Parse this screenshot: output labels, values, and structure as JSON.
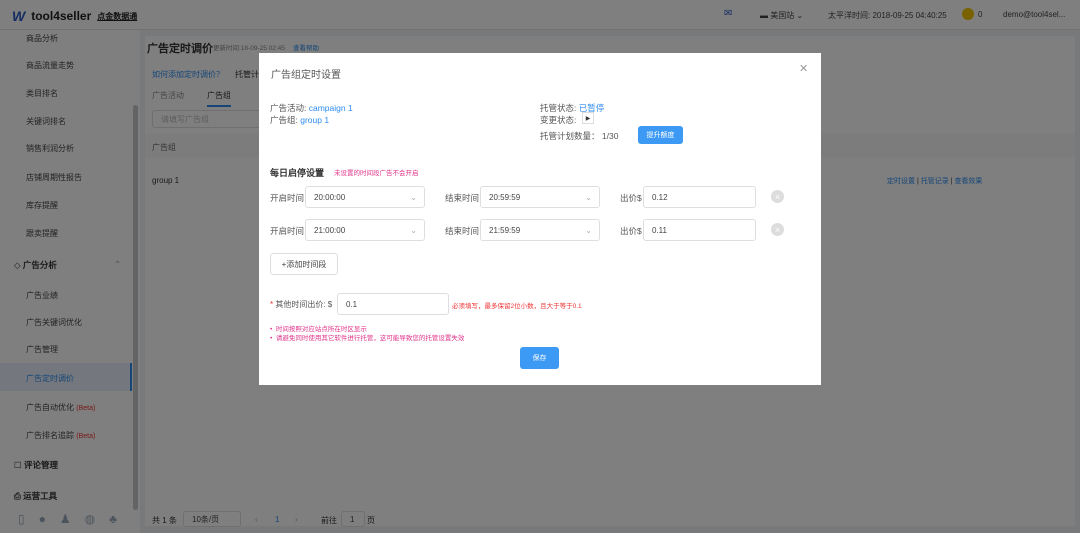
{
  "topbar": {
    "brand": "tool4seller",
    "brand_sub": "点金数据通",
    "marketplace": "美国站",
    "time": "太平洋时间: 2018-09-25 04:40:25",
    "coins": "0",
    "user": "demo@tool4sel..."
  },
  "sidebar": {
    "items": [
      "商品分析",
      "商品流量走势",
      "类目排名",
      "关键词排名",
      "销售利润分析",
      "店铺周期性报告",
      "库存提醒",
      "跟卖提醒"
    ],
    "group_ads": "广告分析",
    "ad_items": [
      "广告业绩",
      "广告关键词优化",
      "广告管理",
      "广告定时调价",
      "广告自动优化",
      "广告排名追踪"
    ],
    "beta": "(Beta)",
    "group_reviews": "评论管理",
    "group_tools": "运营工具"
  },
  "main": {
    "title": "广告定时调价",
    "updated": "更新时间:18-09-25 02:45",
    "help": "查看帮助",
    "how_link": "如何添加定时调价？",
    "hosted": "托管计",
    "tabs": [
      "广告活动",
      "广告组"
    ],
    "search_placeholder": "请填写广告组",
    "col_header": "广告组",
    "row_name": "group 1",
    "row_actions": [
      "定时设置",
      "托管记录",
      "查看效果"
    ],
    "pagination": {
      "total": "共 1 条",
      "per_page": "10条/页",
      "current": "1",
      "goto": "前往",
      "goto_value": "1",
      "page_suffix": "页"
    }
  },
  "modal": {
    "title": "广告组定时设置",
    "campaign_label": "广告活动:",
    "campaign": "campaign 1",
    "group_label": "广告组:",
    "group": "group 1",
    "status_label": "托管状态:",
    "status": "已暂停",
    "change_label": "变更状态:",
    "plan_label": "托管计划数量：",
    "plan_count": "1/30",
    "upgrade": "提升额度",
    "section": "每日启停设置",
    "section_note": "未设置的时间段广告不会开启",
    "rows": [
      {
        "start_label": "开启时间",
        "start": "20:00:00",
        "end_label": "结束时间",
        "end": "20:59:59",
        "bid_label": "出价$",
        "bid": "0.12"
      },
      {
        "start_label": "开启时间",
        "start": "21:00:00",
        "end_label": "结束时间",
        "end": "21:59:59",
        "bid_label": "出价$",
        "bid": "0.11"
      }
    ],
    "add": "+添加时间段",
    "other_label": "其他时间出价: $",
    "other_value": "0.1",
    "other_hint": "必须填写，最多保留2位小数，且大于等于0.1",
    "notes": [
      "时间按照对应站点所在时区显示",
      "请避免同时使用其它软件进行托管，这可能导致您的托管设置失效"
    ],
    "save": "保存"
  }
}
